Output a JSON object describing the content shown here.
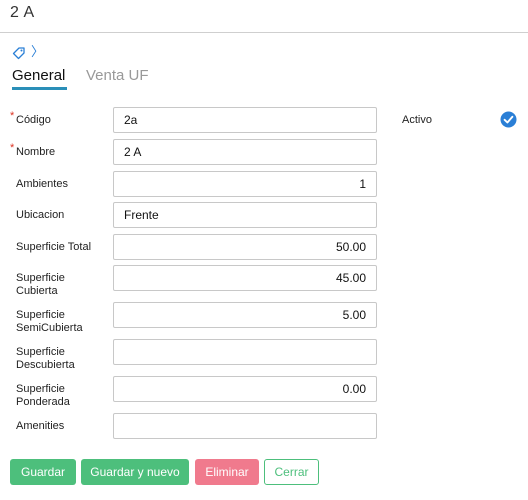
{
  "page": {
    "title": "2 A"
  },
  "tabs": [
    {
      "label": "General",
      "active": true
    },
    {
      "label": "Venta UF",
      "active": false
    }
  ],
  "icons": {
    "tag": "tag-icon",
    "chevron": "chevron-right-icon",
    "check": "check-circle-icon"
  },
  "colors": {
    "accent": "#2a8fb8",
    "save": "#4dbf7c",
    "delete": "#f07a8d",
    "check": "#2a7fd6",
    "required": "#d32222"
  },
  "form": {
    "codigo": {
      "label": "Código",
      "value": "2a",
      "required": true
    },
    "nombre": {
      "label": "Nombre",
      "value": "2 A",
      "required": true
    },
    "ambientes": {
      "label": "Ambientes",
      "value": "1"
    },
    "ubicacion": {
      "label": "Ubicacion",
      "value": "Frente"
    },
    "superficie_total": {
      "label": "Superficie Total",
      "value": "50.00"
    },
    "superficie_cubierta": {
      "label_line1": "Superficie",
      "label_line2": "Cubierta",
      "value": "45.00"
    },
    "superficie_semicubierta": {
      "label_line1": "Superficie",
      "label_line2": "SemiCubierta",
      "value": "5.00"
    },
    "superficie_descubierta": {
      "label_line1": "Superficie",
      "label_line2": "Descubierta",
      "value": ""
    },
    "superficie_ponderada": {
      "label_line1": "Superficie",
      "label_line2": "Ponderada",
      "value": "0.00"
    },
    "amenities": {
      "label": "Amenities",
      "value": ""
    },
    "activo": {
      "label": "Activo",
      "checked": true
    }
  },
  "buttons": {
    "save": "Guardar",
    "save_new": "Guardar y nuevo",
    "delete": "Eliminar",
    "close": "Cerrar"
  }
}
